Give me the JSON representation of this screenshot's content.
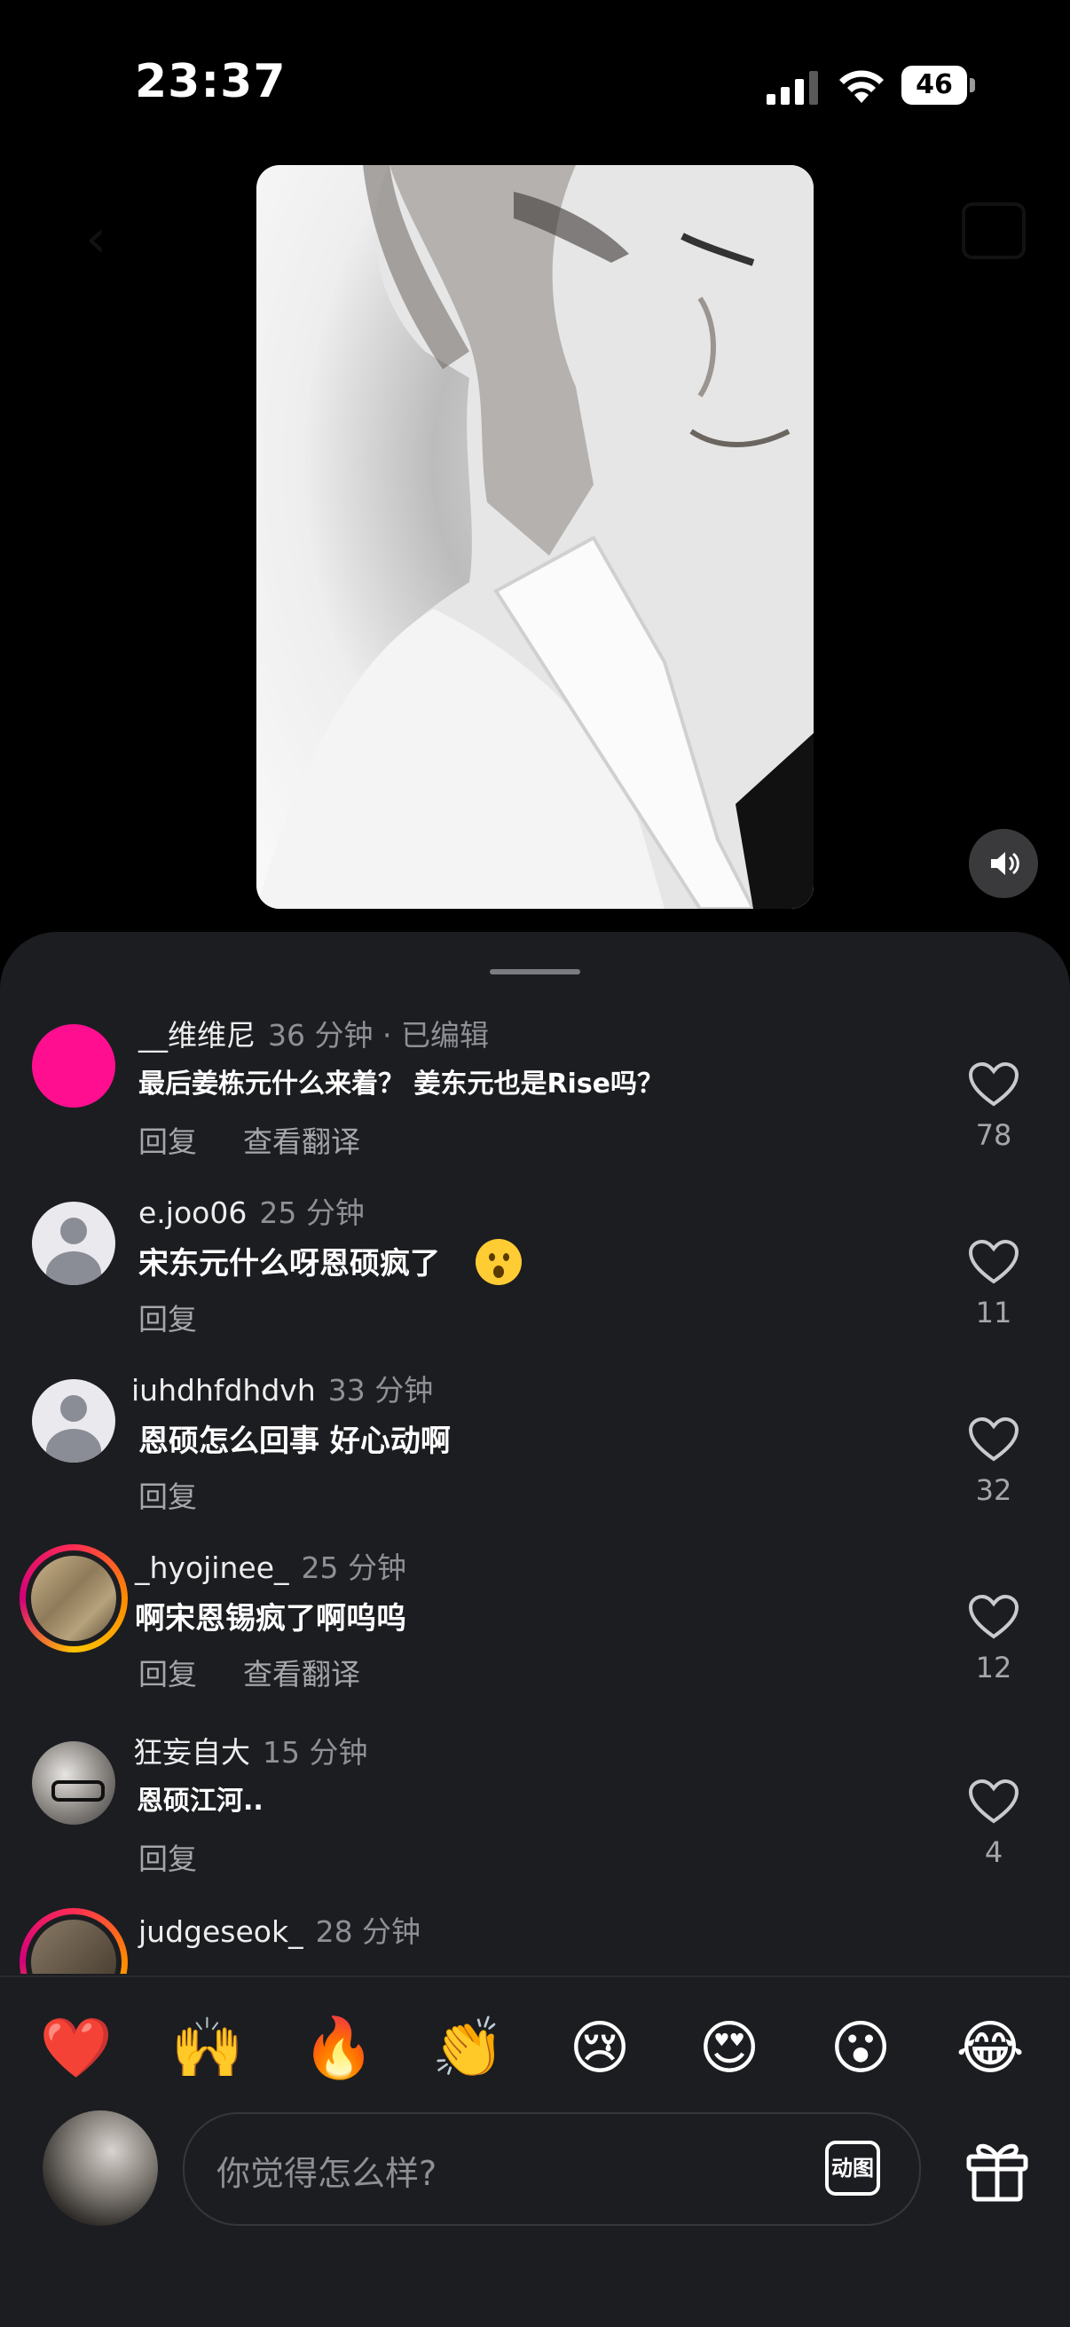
{
  "status_bar": {
    "time": "23:37",
    "battery": "46"
  },
  "comments": [
    {
      "username": "__维维尼",
      "meta": "36 分钟 · 已编辑",
      "text": "最后姜栋元什么来着？ 姜东元也是Rise吗？",
      "reply": "回复",
      "translate": "查看翻译",
      "likes": "78",
      "avatar": "pink"
    },
    {
      "username": "e.joo06",
      "meta": "25 分钟",
      "text": "宋东元什么呀恩硕疯了",
      "reply": "回复",
      "likes": "11",
      "avatar": "default",
      "emoji": "face-open-mouth"
    },
    {
      "username": "iuhdhfdhdvh",
      "meta": "33 分钟",
      "text": "恩硕怎么回事 好心动啊",
      "reply": "回复",
      "likes": "32",
      "avatar": "default"
    },
    {
      "username": "_hyojinee_",
      "meta": "25 分钟",
      "text": "啊宋恩锡疯了啊呜呜",
      "reply": "回复",
      "translate": "查看翻译",
      "likes": "12",
      "avatar": "story-ring"
    },
    {
      "username": "狂妄自大",
      "meta": "15 分钟",
      "text": "恩硕江河..",
      "reply": "回复",
      "likes": "4",
      "avatar": "photo"
    },
    {
      "username": "judgeseok_",
      "meta": "28 分钟",
      "avatar": "story-ring"
    }
  ],
  "quick_emojis": [
    "❤️",
    "🙌",
    "🔥",
    "👏",
    "😢",
    "😍",
    "😮",
    "😂"
  ],
  "composer": {
    "placeholder": "你觉得怎么样?",
    "gif_label": "动图"
  }
}
